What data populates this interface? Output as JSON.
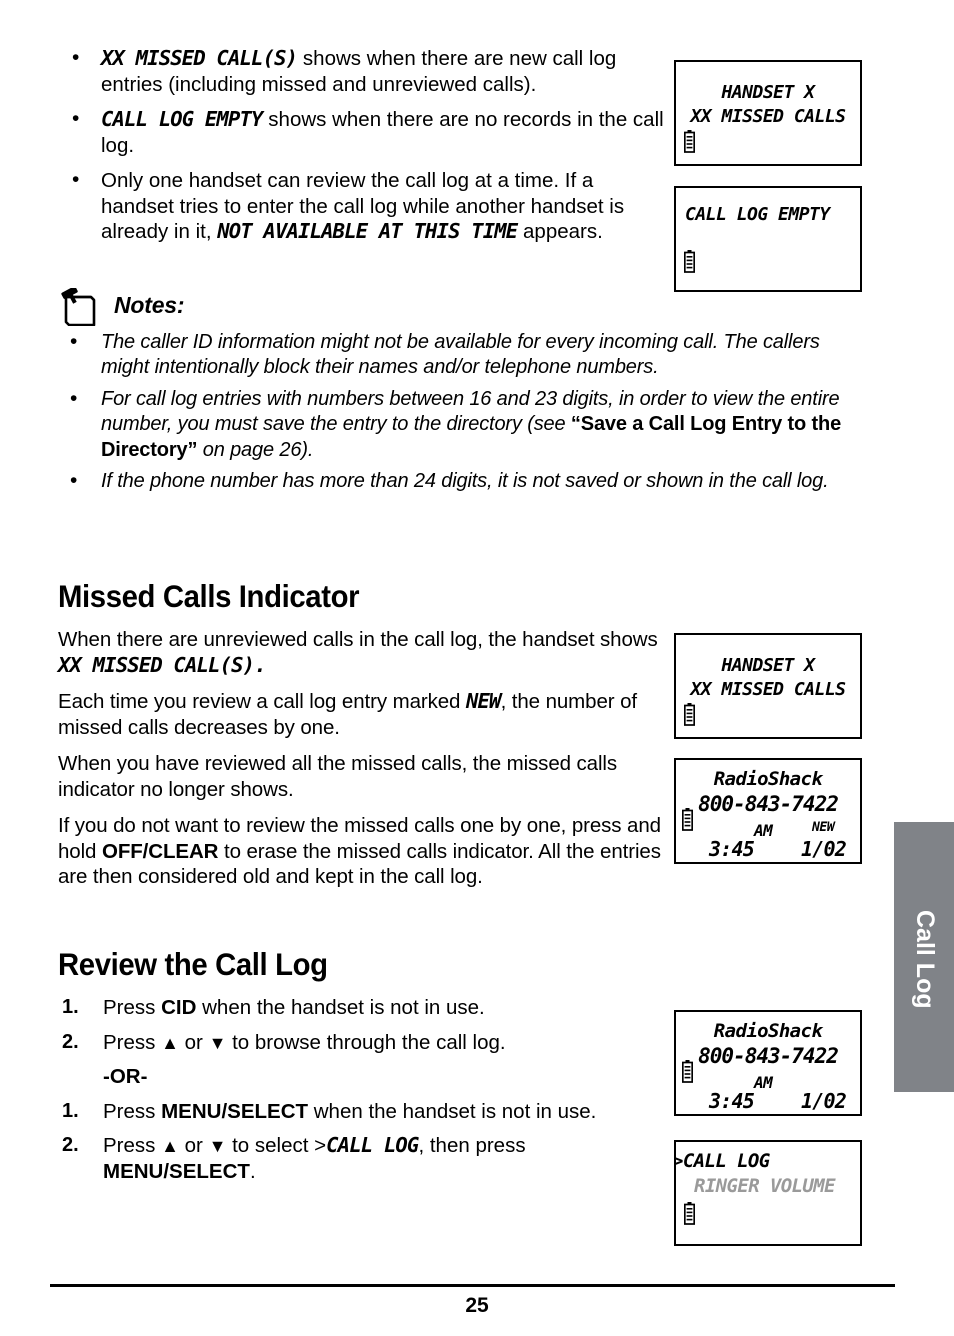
{
  "page_number": "25",
  "side_tab": {
    "label": "Call Log",
    "color": "#808388"
  },
  "top_bullets": [
    {
      "lcd_lead": "XX MISSED CALL(S)",
      "text_after": " shows when there are new call log entries (including missed and unreviewed calls)."
    },
    {
      "lcd_lead": "CALL LOG EMPTY",
      "text_after": " shows when there are no records in the call log."
    },
    {
      "text_before": "Only one handset can review the call log at a time. If a handset tries to enter the call log while another handset is already in it, ",
      "lcd_mid": "NOT AVAILABLE AT THIS TIME",
      "text_after": " appears."
    }
  ],
  "notes": {
    "icon": "note-pushpin-icon",
    "title": "Notes:",
    "items": [
      {
        "text": "The caller ID information might not be available for every incoming call. The callers might intentionally block their names and/or telephone numbers."
      },
      {
        "text_before": "For call log entries with numbers between 16 and 23 digits, in order to view the entire number, you must save the entry to the directory (see ",
        "bold": "“Save a Call Log Entry to the Directory”",
        "text_after": " on page 26)."
      },
      {
        "text": "If the phone number has more than 24 digits, it is not saved or shown in the call log."
      }
    ]
  },
  "missed_calls_section": {
    "heading": "Missed Calls Indicator",
    "para1_before": "When there are unreviewed calls in the call log, the handset shows ",
    "para1_lcd": "XX MISSED CALL(S).",
    "para2_before": "Each time you review a call log entry marked ",
    "para2_lcd": "NEW",
    "para2_after": ", the number of missed calls decreases by one.",
    "para3": "When you have reviewed all the missed calls, the missed calls indicator no longer shows.",
    "para4_before": "If you do not want to review the missed calls one by one, press and hold ",
    "para4_bold": "OFF/CLEAR",
    "para4_after": " to erase the missed calls indicator. All the entries are then considered old and kept in the call log."
  },
  "review_section": {
    "heading": "Review the Call Log",
    "group_a": [
      {
        "num": "1.",
        "before": "Press ",
        "bold": "CID",
        "after": " when the handset is not in use."
      },
      {
        "num": "2.",
        "before": "Press ",
        "up": "▲",
        "mid": " or ",
        "down": "▼",
        "after": " to browse through the call log."
      }
    ],
    "or_label": "-OR-",
    "group_b": [
      {
        "num": "1.",
        "before": "Press ",
        "bold": "MENU/SELECT",
        "after": " when the handset is not in use."
      },
      {
        "num": "2.",
        "before": "Press ",
        "up": "▲",
        "mid": " or ",
        "down": "▼",
        "before2": " to select >",
        "lcd": "CALL LOG",
        "after": ", then press ",
        "bold2": "MENU/SELECT",
        "end": "."
      }
    ]
  },
  "screens": {
    "handset_missed_top": {
      "line1": "HANDSET X",
      "line2": "XX MISSED CALLS",
      "battery": "battery-icon"
    },
    "call_log_empty": {
      "line1": "CALL LOG EMPTY",
      "battery": "battery-icon"
    },
    "handset_missed_mid": {
      "line1": "HANDSET X",
      "line2": "XX MISSED CALLS",
      "battery": "battery-icon"
    },
    "caller_id_new": {
      "name": "RadioShack",
      "number": "800-843-7422",
      "time": "3:45",
      "ampm": "AM",
      "badge": "NEW",
      "index": "1/02",
      "battery": "battery-icon"
    },
    "caller_id_plain": {
      "name": "RadioShack",
      "number": "800-843-7422",
      "time": "3:45",
      "ampm": "AM",
      "index": "1/02",
      "battery": "battery-icon"
    },
    "menu_call_log": {
      "selected": ">CALL LOG",
      "unselected": "RINGER VOLUME",
      "unselected_color": "#9a9a9a",
      "battery": "battery-icon"
    }
  }
}
